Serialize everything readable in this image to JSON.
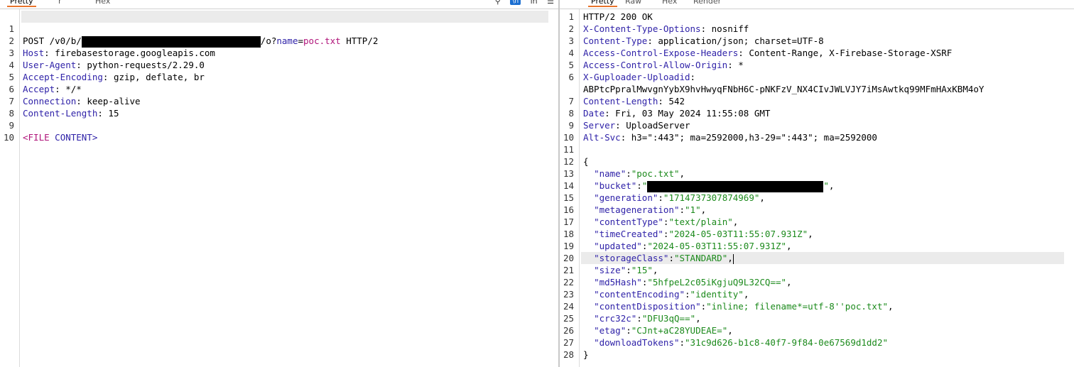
{
  "request": {
    "tabs": [
      "Pretty",
      "r",
      "Hex"
    ],
    "active_tab": "Pretty",
    "toolbar_icons": [
      "search-icon",
      "toggle-badge-icon",
      "newline-icon",
      "menu-icon"
    ],
    "line1": {
      "method": "POST",
      "path_prefix": " /v0/b/",
      "path_suffix": "/o?",
      "param_name": "name",
      "eq": "=",
      "param_value": "poc.txt",
      "version": " HTTP/2"
    },
    "headers": [
      {
        "name": "Host",
        "value": "firebasestorage.googleapis.com"
      },
      {
        "name": "User-Agent",
        "value": "python-requests/2.29.0"
      },
      {
        "name": "Accept-Encoding",
        "value": "gzip, deflate, br"
      },
      {
        "name": "Accept",
        "value": "*/*"
      },
      {
        "name": "Connection",
        "value": "keep-alive"
      },
      {
        "name": "Content-Length",
        "value": "15"
      }
    ],
    "body": {
      "open": "<",
      "tag": "FILE",
      "rest": " CONTENT>"
    },
    "line_numbers": [
      "1",
      "2",
      "3",
      "4",
      "5",
      "6",
      "7",
      "8",
      "9",
      "10"
    ]
  },
  "response": {
    "tabs": [
      "Pretty",
      "Raw",
      "Hex",
      "Render"
    ],
    "active_tab": "Pretty",
    "status_line": "HTTP/2 200 OK",
    "headers": [
      {
        "name": "X-Content-Type-Options",
        "value": "nosniff"
      },
      {
        "name": "Content-Type",
        "value": "application/json; charset=UTF-8"
      },
      {
        "name": "Access-Control-Expose-Headers",
        "value": "Content-Range, X-Firebase-Storage-XSRF"
      },
      {
        "name": "Access-Control-Allow-Origin",
        "value": "*"
      },
      {
        "name": "X-Guploader-Uploadid",
        "value": ""
      },
      {
        "name": "Content-Length",
        "value": "542"
      },
      {
        "name": "Date",
        "value": "Fri, 03 May 2024 11:55:08 GMT"
      },
      {
        "name": "Server",
        "value": "UploadServer"
      },
      {
        "name": "Alt-Svc",
        "value": "h3=\":443\"; ma=2592000,h3-29=\":443\"; ma=2592000"
      }
    ],
    "uploadid_wrap": "ABPtcPpralMwvgnYybX9hvHwyqFNbH6C-pNKFzV_NX4CIvJWLVJY7iMsAwtkq99MFmHAxKBM4oY",
    "json_open": "{",
    "json_close": "}",
    "json_fields": [
      {
        "key": "name",
        "value": "poc.txt"
      },
      {
        "key": "bucket",
        "value": ""
      },
      {
        "key": "generation",
        "value": "1714737307874969"
      },
      {
        "key": "metageneration",
        "value": "1"
      },
      {
        "key": "contentType",
        "value": "text/plain"
      },
      {
        "key": "timeCreated",
        "value": "2024-05-03T11:55:07.931Z"
      },
      {
        "key": "updated",
        "value": "2024-05-03T11:55:07.931Z"
      },
      {
        "key": "storageClass",
        "value": "STANDARD"
      },
      {
        "key": "size",
        "value": "15"
      },
      {
        "key": "md5Hash",
        "value": "5hfpeL2c05iKgjuQ9L32CQ=="
      },
      {
        "key": "contentEncoding",
        "value": "identity"
      },
      {
        "key": "contentDisposition",
        "value": "inline; filename*=utf-8''poc.txt"
      },
      {
        "key": "crc32c",
        "value": "DFU3qQ=="
      },
      {
        "key": "etag",
        "value": "CJnt+aC28YUDEAE="
      },
      {
        "key": "downloadTokens",
        "value": "31c9d626-b1c8-40f7-9f84-0e67569d1dd2"
      }
    ],
    "punct": {
      "quote": "\"",
      "colon": ":",
      "comma": ","
    },
    "line_numbers": [
      "1",
      "2",
      "3",
      "4",
      "5",
      "6",
      "7",
      "8",
      "9",
      "10",
      "11",
      "12",
      "13",
      "14",
      "15",
      "16",
      "17",
      "18",
      "19",
      "20",
      "21",
      "22",
      "23",
      "24",
      "25",
      "26",
      "27",
      "28"
    ]
  }
}
